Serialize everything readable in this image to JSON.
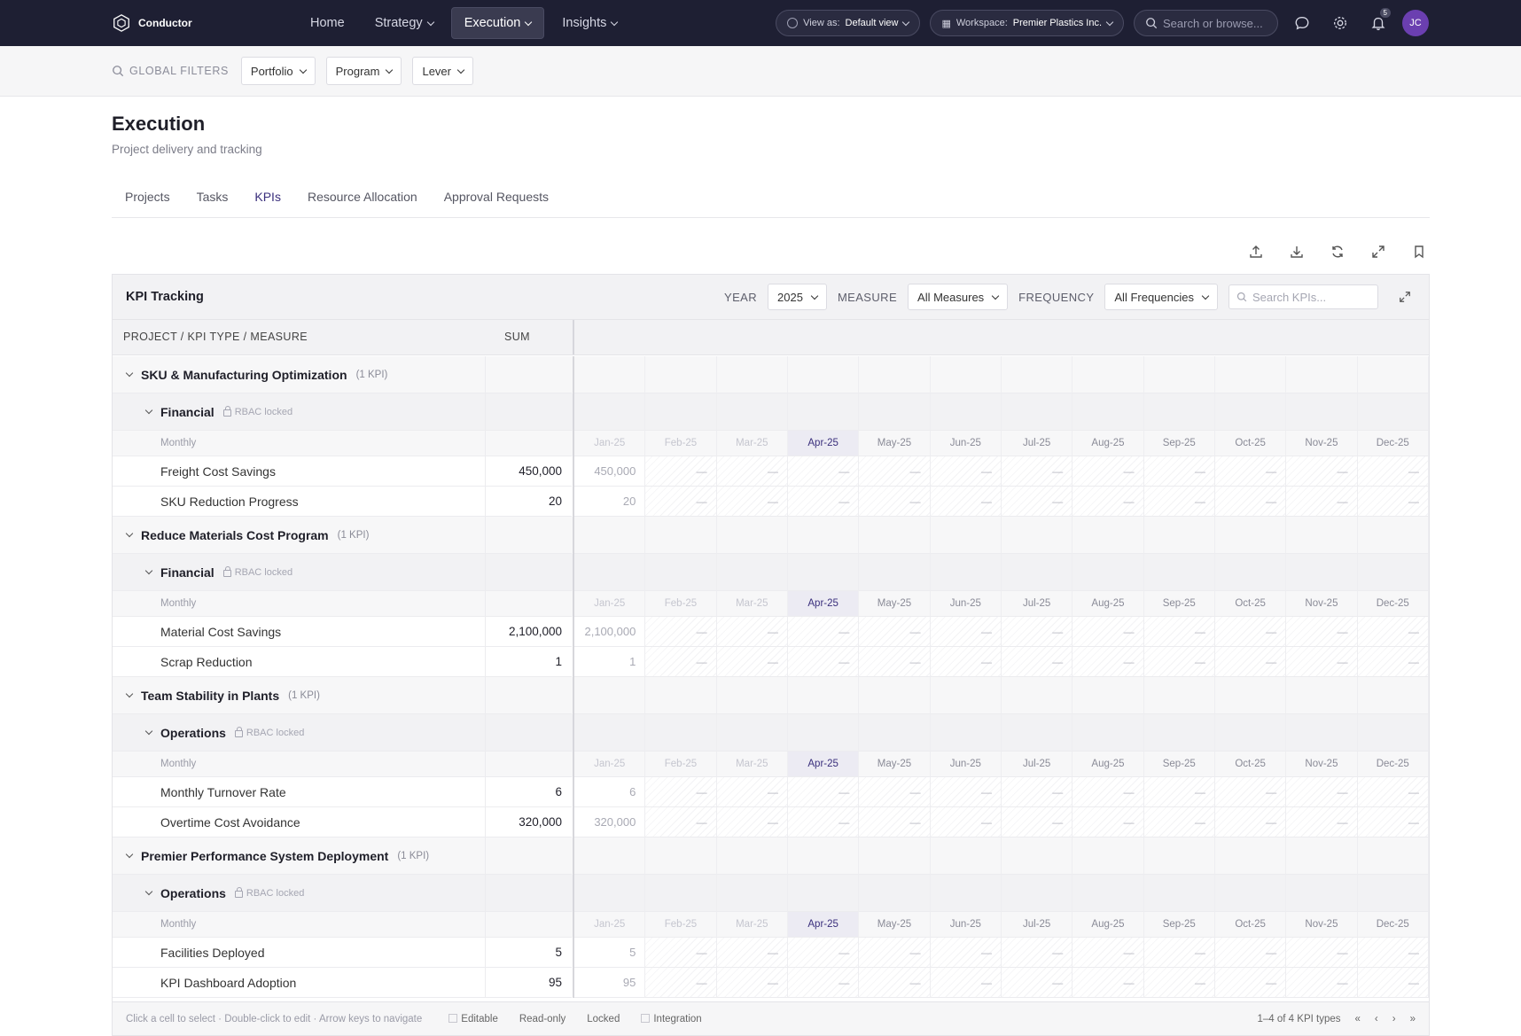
{
  "brand": {
    "name": "Conductor"
  },
  "nav": {
    "items": [
      {
        "label": "Home",
        "dropdown": false,
        "active": false
      },
      {
        "label": "Strategy",
        "dropdown": true,
        "active": false
      },
      {
        "label": "Execution",
        "dropdown": true,
        "active": true
      },
      {
        "label": "Insights",
        "dropdown": true,
        "active": false
      }
    ],
    "view_as_label": "View as:",
    "view_as_value": "Default view",
    "workspace_label": "Workspace:",
    "workspace_value": "Premier Plastics Inc.",
    "search_placeholder": "Search or browse...",
    "notifications_count": "5",
    "avatar_initials": "JC"
  },
  "global_filters": {
    "label": "GLOBAL FILTERS",
    "filters": [
      "Portfolio",
      "Program",
      "Lever"
    ]
  },
  "page": {
    "title": "Execution",
    "subtitle": "Project delivery and tracking",
    "tabs": [
      {
        "label": "Projects",
        "active": false
      },
      {
        "label": "Tasks",
        "active": false
      },
      {
        "label": "KPIs",
        "active": true
      },
      {
        "label": "Resource Allocation",
        "active": false
      },
      {
        "label": "Approval Requests",
        "active": false
      }
    ]
  },
  "kpi_panel": {
    "title": "KPI Tracking",
    "year_label": "YEAR",
    "year_value": "2025",
    "measure_label": "MEASURE",
    "measure_value": "All Measures",
    "frequency_label": "FREQUENCY",
    "frequency_value": "All Frequencies",
    "search_placeholder": "Search KPIs...",
    "col_label": "PROJECT / KPI TYPE / MEASURE",
    "col_sum": "SUM",
    "months": [
      "Jan-25",
      "Feb-25",
      "Mar-25",
      "Apr-25",
      "May-25",
      "Jun-25",
      "Jul-25",
      "Aug-25",
      "Sep-25",
      "Oct-25",
      "Nov-25",
      "Dec-25"
    ],
    "locked_months": 3,
    "current_month": "Apr-25",
    "empty_cell": "—",
    "frequency": "Monthly",
    "rbac_label": "RBAC locked",
    "projects": [
      {
        "name": "SKU & Manufacturing Optimization",
        "count": "(1 KPI)",
        "type": "Financial",
        "kpis": [
          {
            "name": "Freight Cost Savings",
            "sum": "450,000",
            "jan": "450,000"
          },
          {
            "name": "SKU Reduction Progress",
            "sum": "20",
            "jan": "20"
          }
        ]
      },
      {
        "name": "Reduce Materials Cost Program",
        "count": "(1 KPI)",
        "type": "Financial",
        "kpis": [
          {
            "name": "Material Cost Savings",
            "sum": "2,100,000",
            "jan": "2,100,000"
          },
          {
            "name": "Scrap Reduction",
            "sum": "1",
            "jan": "1"
          }
        ]
      },
      {
        "name": "Team Stability in Plants",
        "count": "(1 KPI)",
        "type": "Operations",
        "kpis": [
          {
            "name": "Monthly Turnover Rate",
            "sum": "6",
            "jan": "6"
          },
          {
            "name": "Overtime Cost Avoidance",
            "sum": "320,000",
            "jan": "320,000"
          }
        ]
      },
      {
        "name": "Premier Performance System Deployment",
        "count": "(1 KPI)",
        "type": "Operations",
        "kpis": [
          {
            "name": "Facilities Deployed",
            "sum": "5",
            "jan": "5"
          },
          {
            "name": "KPI Dashboard Adoption",
            "sum": "95",
            "jan": "95"
          }
        ]
      }
    ],
    "footer": {
      "hint": "Click a cell to select · Double-click to edit · Arrow keys to navigate",
      "legend": [
        "Editable",
        "Read-only",
        "Locked",
        "Integration"
      ],
      "pagination": "1–4 of 4 KPI types"
    }
  }
}
